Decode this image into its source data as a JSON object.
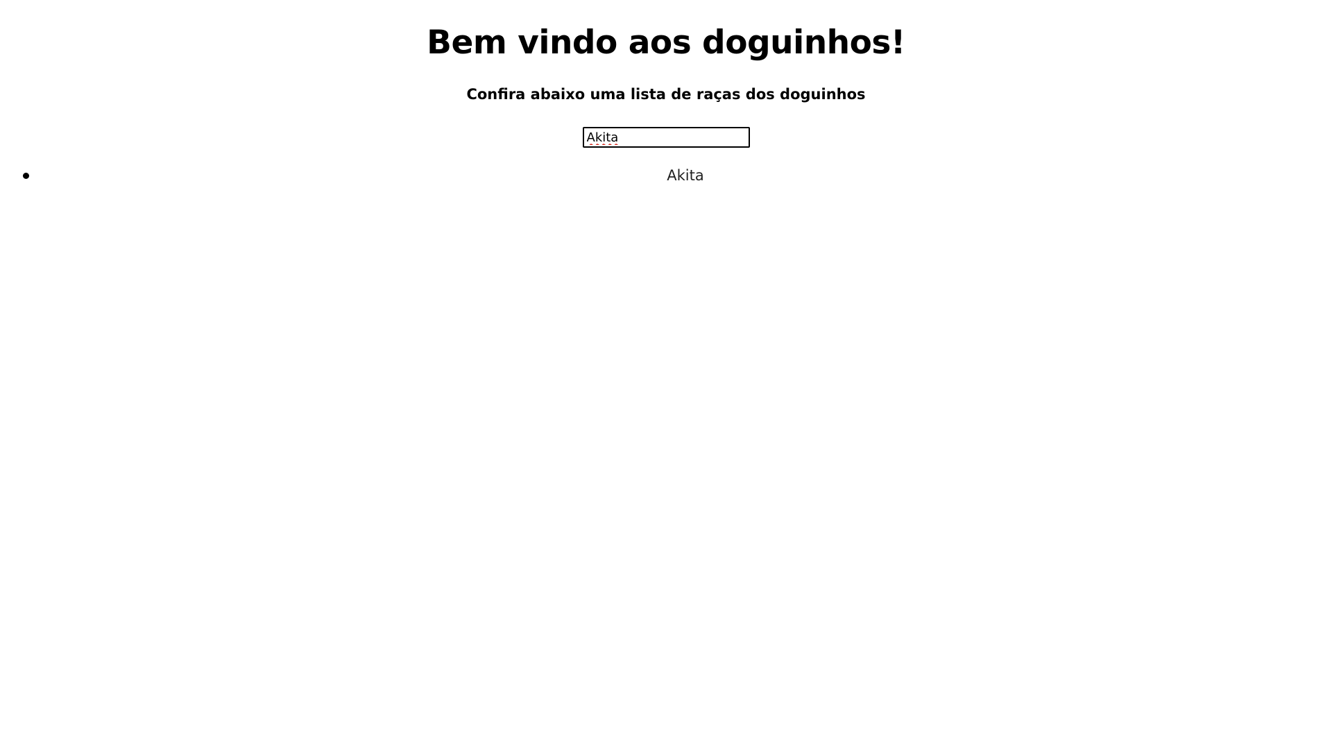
{
  "header": {
    "title": "Bem vindo aos doguinhos!",
    "subtitle": "Confira abaixo uma lista de raças dos doguinhos"
  },
  "search": {
    "value": "Akita"
  },
  "breeds": {
    "items": [
      {
        "name": "Akita"
      }
    ]
  }
}
